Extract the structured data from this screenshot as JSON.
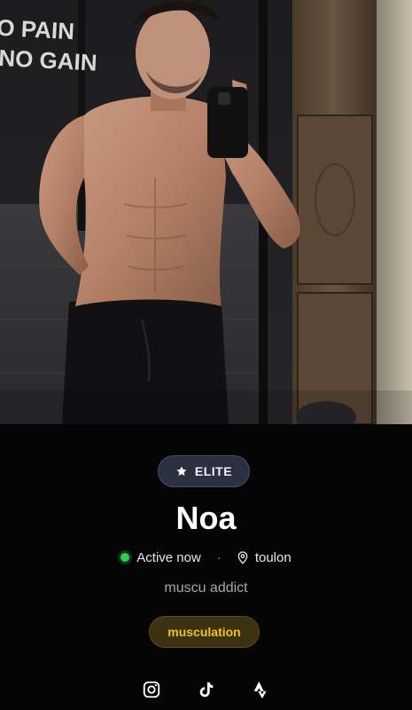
{
  "profile": {
    "badge_label": "ELITE",
    "name": "Noa",
    "status_label": "Active now",
    "separator": "·",
    "location": "toulon",
    "bio": "muscu addict",
    "tags": [
      "musculation"
    ],
    "photo_wall_text": [
      "O PAIN",
      "NO GAIN"
    ]
  },
  "icons": {
    "badge": "star-icon",
    "location": "map-pin-icon",
    "socials": [
      "instagram-icon",
      "tiktok-icon",
      "strava-icon"
    ]
  },
  "colors": {
    "status_online": "#34c759",
    "tag_text": "#f1c21a",
    "badge_bg": "#2a3040",
    "background": "#050505"
  }
}
